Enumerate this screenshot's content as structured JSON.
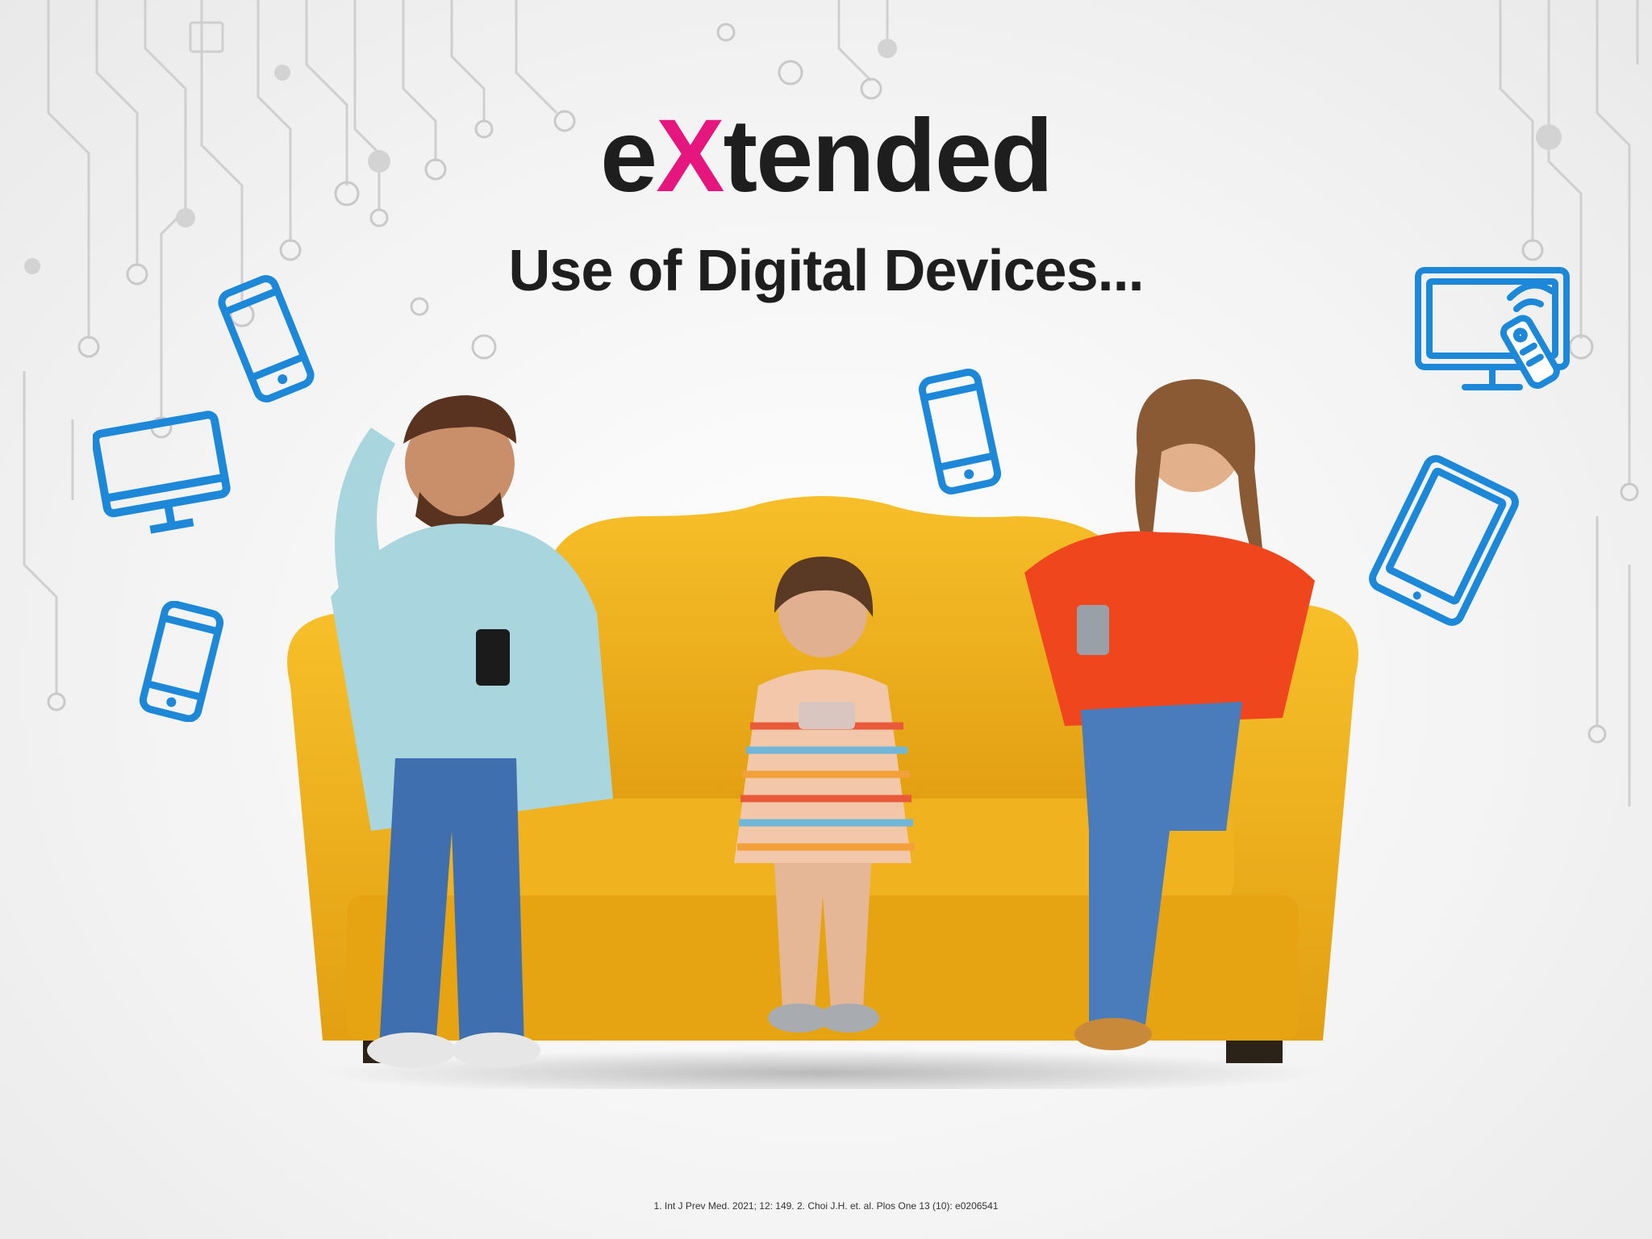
{
  "headline": {
    "prefix": "e",
    "accent": "X",
    "suffix": "tended"
  },
  "subhead": "Use of Digital Devices...",
  "footnote": "1. Int J Prev Med. 2021; 12: 149.    2. Choi J.H. et. al. Plos One 13 (10): e0206541",
  "colors": {
    "accent_pink": "#e5177e",
    "icon_blue": "#1e88d8",
    "sofa_yellow": "#f2b21c",
    "text_dark": "#1e1e1e"
  },
  "icons": [
    "smartphone-icon",
    "desktop-monitor-icon",
    "smartphone-icon",
    "smartphone-icon",
    "tv-remote-icon",
    "tablet-icon"
  ]
}
